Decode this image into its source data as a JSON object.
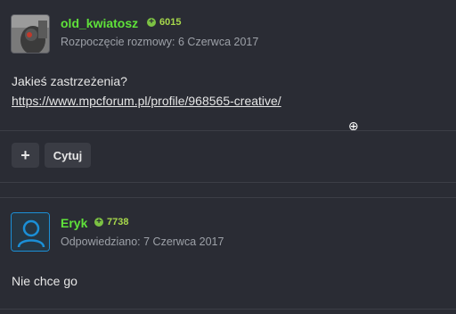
{
  "posts": [
    {
      "username": "old_kwiatosz",
      "reputation": "6015",
      "date": "Rozpoczęcie rozmowy: 6 Czerwca 2017",
      "text": "Jakieś zastrzeżenia?",
      "link": "https://www.mpcforum.pl/profile/968565-creative/"
    },
    {
      "username": "Eryk",
      "reputation": "7738",
      "date": "Odpowiedziano: 7 Czerwca 2017",
      "text": "Nie chce go"
    }
  ],
  "actions": {
    "add_label": "+",
    "quote_label": "Cytuj"
  },
  "icons": {
    "rep": "plus-circle-icon",
    "cursor": "zoom-cursor-icon",
    "avatar2": "user-icon"
  },
  "colors": {
    "background": "#2a2c34",
    "username": "#5fe23a",
    "reputation": "#a7d84b",
    "accent": "#1b8fd6"
  }
}
